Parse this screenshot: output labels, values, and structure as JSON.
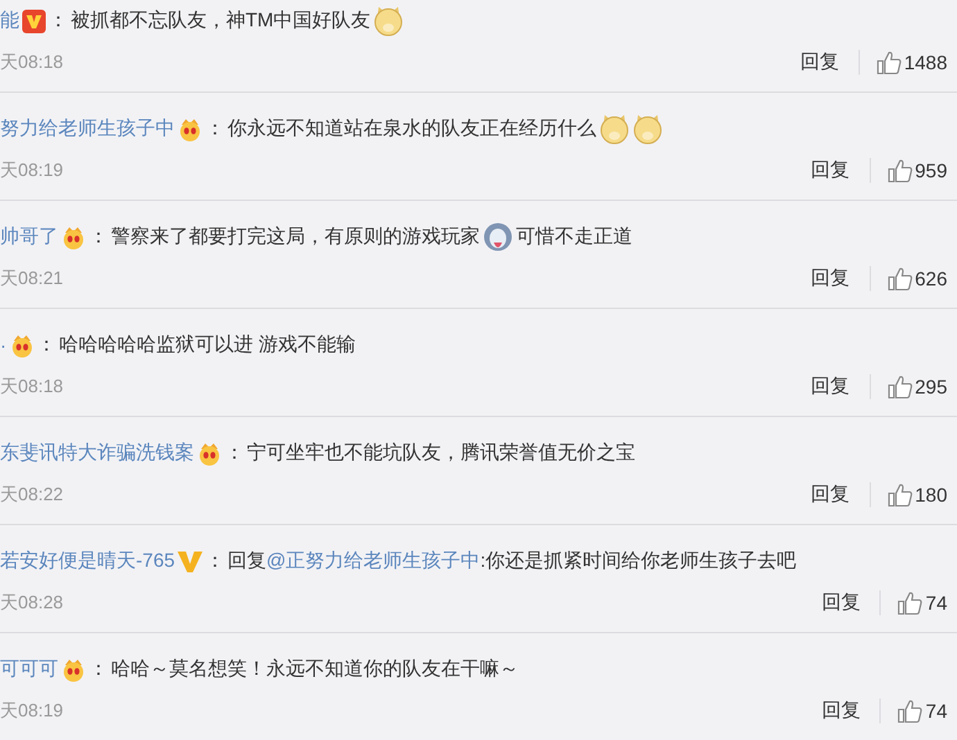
{
  "comments": [
    {
      "user": "能",
      "badge": {
        "kind": "vip"
      },
      "sep": "：",
      "content": [
        {
          "kind": "text",
          "text": "被抓都不忘队友，神TM中国好队友"
        },
        {
          "kind": "doge"
        }
      ],
      "time": "天08:18",
      "reply": "回复",
      "likes": "1488"
    },
    {
      "user": "努力给老师生孩子中",
      "badge": {
        "kind": "crown"
      },
      "sep": "：",
      "content": [
        {
          "kind": "text",
          "text": "你永远不知道站在泉水的队友正在经历什么"
        },
        {
          "kind": "doge"
        },
        {
          "kind": "doge"
        }
      ],
      "time": "天08:19",
      "reply": "回复",
      "likes": "959"
    },
    {
      "user": "帅哥了",
      "badge": {
        "kind": "crown"
      },
      "sep": "：",
      "content": [
        {
          "kind": "text",
          "text": "警察来了都要打完这局，有原则的游戏玩家"
        },
        {
          "kind": "husky"
        },
        {
          "kind": "text",
          "text": "可惜不走正道"
        }
      ],
      "time": "天08:21",
      "reply": "回复",
      "likes": "626"
    },
    {
      "user": "·",
      "badge": {
        "kind": "crown"
      },
      "sep": "：",
      "content": [
        {
          "kind": "text",
          "text": "哈哈哈哈哈监狱可以进 游戏不能输"
        }
      ],
      "time": "天08:18",
      "reply": "回复",
      "likes": "295"
    },
    {
      "user": "东斐讯特大诈骗洗钱案",
      "badge": {
        "kind": "crown"
      },
      "sep": "：",
      "content": [
        {
          "kind": "text",
          "text": "宁可坐牢也不能坑队友，腾讯荣誉值无价之宝"
        }
      ],
      "time": "天08:22",
      "reply": "回复",
      "likes": "180"
    },
    {
      "user": "若安好便是晴天-765",
      "badge": {
        "kind": "v"
      },
      "sep": "：",
      "content": [
        {
          "kind": "text",
          "text": "回复"
        },
        {
          "kind": "mention",
          "text": "@正努力给老师生孩子中"
        },
        {
          "kind": "text",
          "text": ":你还是抓紧时间给你老师生孩子去吧"
        }
      ],
      "time": "天08:28",
      "reply": "回复",
      "likes": "74"
    },
    {
      "user": "可可可",
      "badge": {
        "kind": "crown"
      },
      "sep": "：",
      "content": [
        {
          "kind": "text",
          "text": "哈哈～莫名想笑！永远不知道你的队友在干嘛～"
        }
      ],
      "time": "天08:19",
      "reply": "回复",
      "likes": "74"
    }
  ]
}
